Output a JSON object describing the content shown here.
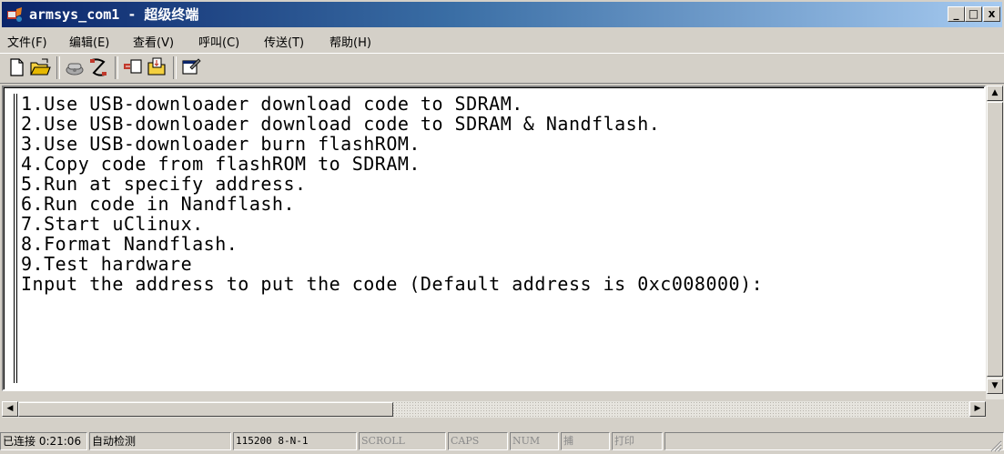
{
  "window": {
    "title": "armsys_com1 - 超级终端",
    "controls": {
      "minimize": "_",
      "maximize": "□",
      "close": "x"
    }
  },
  "menu": [
    {
      "label": "文件(F)"
    },
    {
      "label": "编辑(E)"
    },
    {
      "label": "查看(V)"
    },
    {
      "label": "呼叫(C)"
    },
    {
      "label": "传送(T)"
    },
    {
      "label": "帮助(H)"
    }
  ],
  "toolbar": {
    "icons": [
      "new-file-icon",
      "open-folder-icon",
      "call-icon",
      "disconnect-icon",
      "send-icon",
      "receive-icon",
      "properties-icon"
    ]
  },
  "terminal": {
    "lines": [
      "1.Use USB-downloader download code to SDRAM.",
      "2.Use USB-downloader download code to SDRAM & Nandflash.",
      "3.Use USB-downloader burn flashROM.",
      "4.Copy code from flashROM to SDRAM.",
      "5.Run at specify address.",
      "6.Run code in Nandflash.",
      "7.Start uClinux.",
      "8.Format Nandflash.",
      "9.Test hardware",
      "Input the address to put the code (Default address is 0xc008000):"
    ]
  },
  "statusbar": {
    "connected": "已连接 0:21:06",
    "detect": "自动检测",
    "port_settings": "115200 8-N-1",
    "scroll": "SCROLL",
    "caps": "CAPS",
    "num": "NUM",
    "capture": "捕",
    "print": "打印"
  },
  "colors": {
    "title_gradient_start": "#0a246a",
    "title_gradient_end": "#a6caf0",
    "chrome": "#d4d0c8",
    "terminal_bg": "#ffffff",
    "terminal_text": "#000000"
  }
}
